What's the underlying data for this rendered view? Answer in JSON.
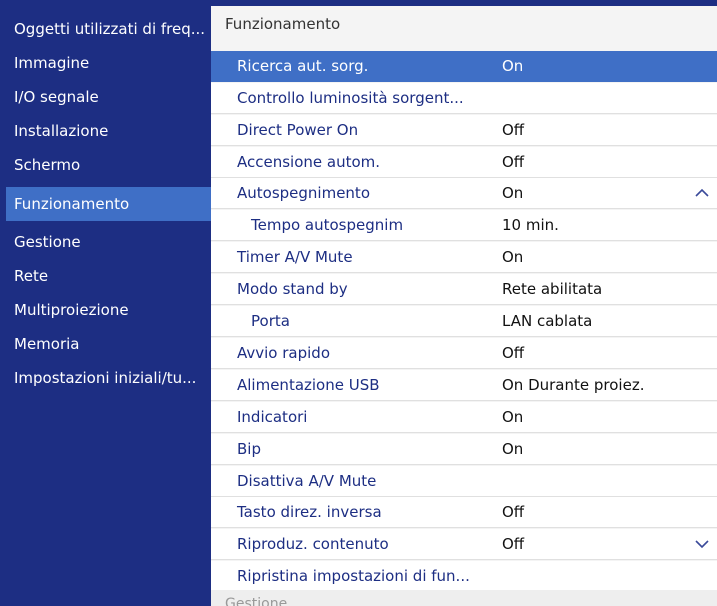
{
  "sidebar": {
    "items": [
      {
        "label": "Oggetti utilizzati di freq..."
      },
      {
        "label": "Immagine"
      },
      {
        "label": "I/O segnale"
      },
      {
        "label": "Installazione"
      },
      {
        "label": "Schermo"
      },
      {
        "label": "Funzionamento"
      },
      {
        "label": "Gestione"
      },
      {
        "label": "Rete"
      },
      {
        "label": "Multiproiezione"
      },
      {
        "label": "Memoria"
      },
      {
        "label": "Impostazioni iniziali/tu..."
      }
    ],
    "selected": "Funzionamento"
  },
  "panel": {
    "title": "Funzionamento",
    "rows": [
      {
        "label": "Ricerca aut. sorg.",
        "value": "On"
      },
      {
        "label": "Controllo luminosità sorgent...",
        "value": ""
      },
      {
        "label": "Direct Power On",
        "value": "Off"
      },
      {
        "label": "Accensione autom.",
        "value": "Off"
      },
      {
        "label": "Autospegnimento",
        "value": "On"
      },
      {
        "label": "Tempo autospegnim",
        "value": "10 min."
      },
      {
        "label": "Timer A/V Mute",
        "value": "On"
      },
      {
        "label": "Modo stand by",
        "value": "Rete abilitata"
      },
      {
        "label": "Porta",
        "value": "LAN cablata"
      },
      {
        "label": "Avvio rapido",
        "value": "Off"
      },
      {
        "label": "Alimentazione USB",
        "value": "On Durante proiez."
      },
      {
        "label": "Indicatori",
        "value": "On"
      },
      {
        "label": "Bip",
        "value": "On"
      },
      {
        "label": "Disattiva A/V Mute",
        "value": ""
      },
      {
        "label": "Tasto direz. inversa",
        "value": "Off"
      },
      {
        "label": "Riproduz. contenuto",
        "value": "Off"
      },
      {
        "label": "Ripristina impostazioni di fun...",
        "value": ""
      }
    ],
    "footer_next": "Gestione"
  },
  "icons": {
    "scroll_up": "chevron-up-icon",
    "scroll_down": "chevron-down-icon"
  },
  "colors": {
    "menu_bg": "#1d2e83",
    "highlight": "#3f6fc6",
    "panel_bg": "#ffffff"
  }
}
